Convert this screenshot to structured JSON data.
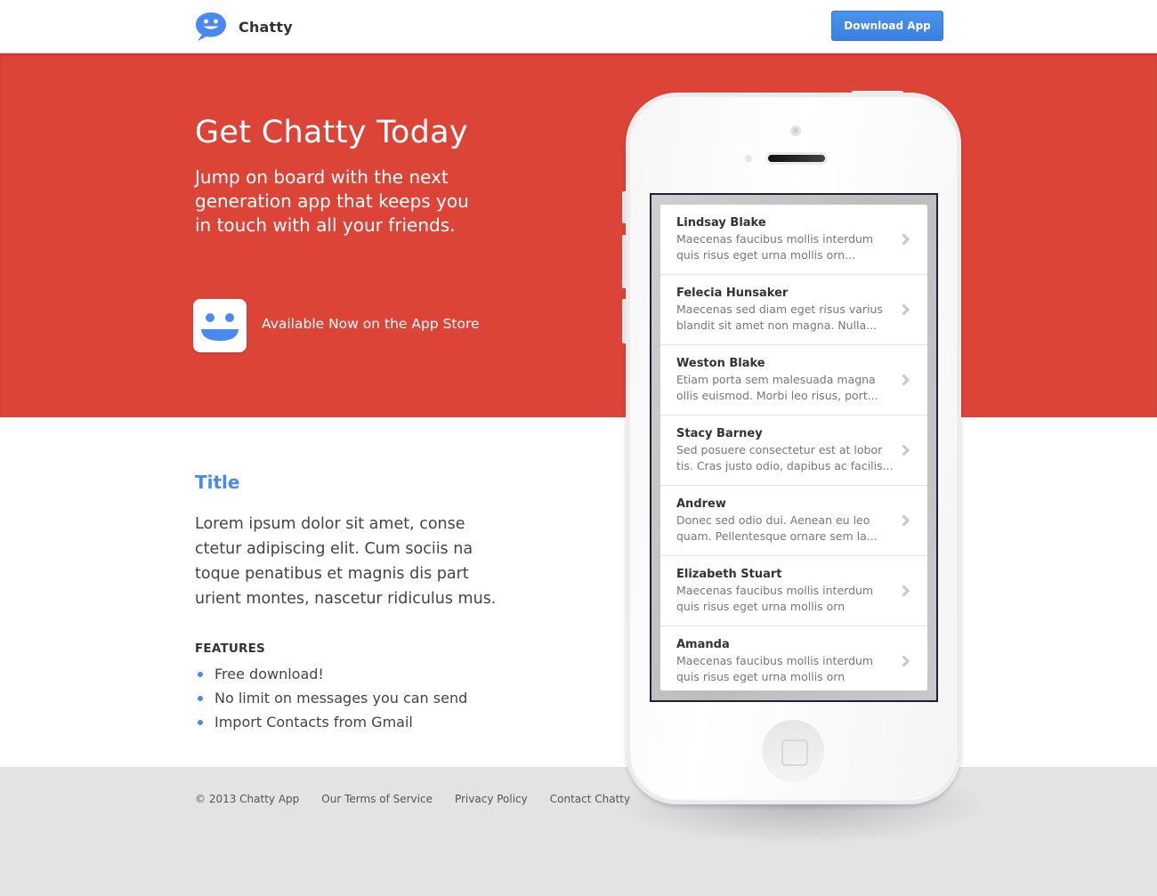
{
  "header": {
    "brand": "Chatty",
    "download_label": "Download App",
    "brand_color": "#4a8af0"
  },
  "hero": {
    "title": "Get Chatty Today",
    "subtitle_lines": [
      "Jump on board with the next",
      "generation app that keeps you",
      "in touch with all your friends."
    ],
    "store_text": "Available Now on the App Store",
    "background": "#db4437"
  },
  "content": {
    "title": "Title",
    "body_lines": [
      "Lorem ipsum dolor sit amet, conse",
      "ctetur adipiscing elit. Cum sociis na",
      "toque penatibus et magnis dis part",
      "urient montes, nascetur ridiculus mus."
    ],
    "features_label": "FEATURES",
    "features": [
      "Free download!",
      "No limit on messages you can send",
      "Import Contacts from Gmail"
    ]
  },
  "phone": {
    "conversations": [
      {
        "name": "Lindsay Blake",
        "lines": [
          "Maecenas faucibus mollis interdum",
          "quis risus eget urna mollis orn..."
        ]
      },
      {
        "name": "Felecia Hunsaker",
        "lines": [
          "Maecenas sed diam eget risus varius",
          "blandit sit amet non magna. Nulla..."
        ]
      },
      {
        "name": "Weston Blake",
        "lines": [
          "Etiam porta sem malesuada magna",
          "ollis euismod. Morbi leo risus, port..."
        ]
      },
      {
        "name": "Stacy Barney",
        "lines": [
          "Sed posuere consectetur est at lobor",
          "tis. Cras justo odio, dapibus ac facilis..."
        ]
      },
      {
        "name": "Andrew",
        "lines": [
          "Donec sed odio dui. Aenean eu leo",
          "quam. Pellentesque ornare sem la..."
        ]
      },
      {
        "name": "Elizabeth Stuart",
        "lines": [
          "Maecenas faucibus mollis interdum",
          "quis risus eget urna mollis orn"
        ]
      },
      {
        "name": "Amanda",
        "lines": [
          "Maecenas faucibus mollis interdum",
          "quis risus eget urna mollis orn"
        ]
      }
    ]
  },
  "footer": {
    "copyright": "© 2013 Chatty App",
    "links": [
      "Our Terms of Service",
      "Privacy Policy",
      "Contact Chatty"
    ]
  }
}
